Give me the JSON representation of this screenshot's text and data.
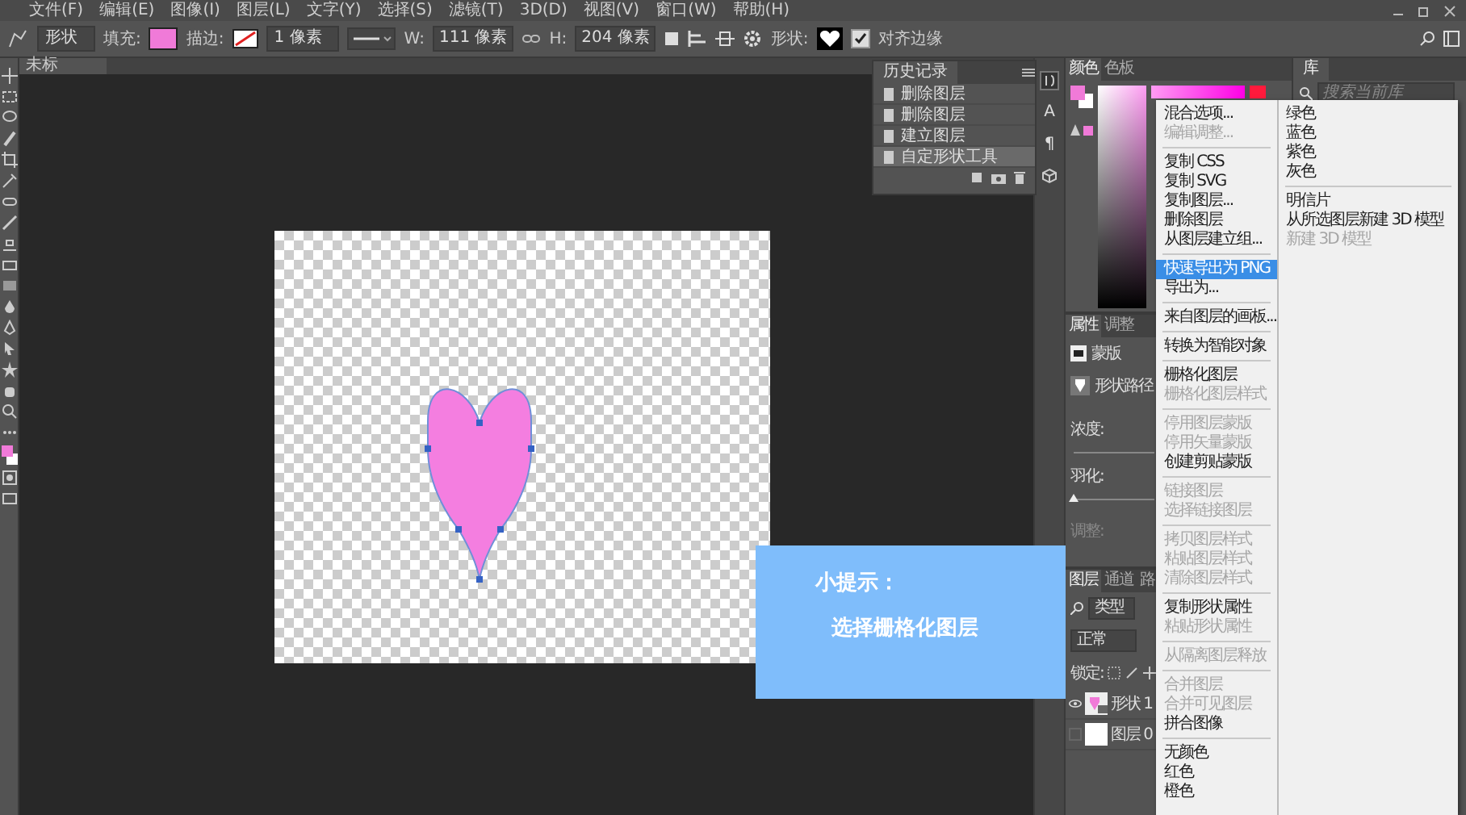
{
  "menu_bar": {
    "items": [
      "文件(F)",
      "编辑(E)",
      "图像(I)",
      "图层(L)",
      "文字(Y)",
      "选择(S)",
      "滤镜(T)",
      "3D(D)",
      "视图(V)",
      "窗口(W)",
      "帮助(H)"
    ]
  },
  "options_bar": {
    "tool_mode": "形状",
    "fill_label": "填充:",
    "stroke_label": "描边:",
    "stroke_width": "1 像素",
    "width_label": "W:",
    "width_value": "111 像素",
    "height_label": "H:",
    "height_value": "204 像素",
    "shape_label": "形状:",
    "align_edges": {
      "label": "对齐边缘",
      "checked": true
    }
  },
  "document": {
    "tab": "未标"
  },
  "history": {
    "title": "历史记录",
    "items": [
      {
        "label": "删除图层",
        "selected": false
      },
      {
        "label": "删除图层",
        "selected": false
      },
      {
        "label": "建立图层",
        "selected": false
      },
      {
        "label": "自定形状工具",
        "selected": true
      }
    ]
  },
  "panel_dock": {
    "glyph_buttons": [
      "A",
      "¶"
    ]
  },
  "color_panel": {
    "tabs": [
      {
        "label": "颜色",
        "selected": true
      },
      {
        "label": "色板",
        "selected": false
      }
    ]
  },
  "properties": {
    "tabs": [
      {
        "label": "属性",
        "selected": true
      },
      {
        "label": "调整",
        "selected": false
      }
    ],
    "mask_label": "蒙版",
    "shape_path_label": "形状路径",
    "density_label": "浓度:",
    "feather": {
      "label": "羽化:",
      "level": 0
    },
    "adjust": {
      "label": "调整:",
      "disabled": true
    }
  },
  "layers": {
    "tabs": [
      {
        "label": "图层",
        "selected": true
      },
      {
        "label": "通道",
        "selected": false
      },
      {
        "label": "路",
        "selected": false
      }
    ],
    "filter": "类型",
    "blend_mode": "正常",
    "lock_label": "锁定:",
    "items": [
      {
        "name": "形状 1",
        "visible": true,
        "kind": "shape"
      },
      {
        "name": "图层 0",
        "visible": false,
        "kind": "fill"
      }
    ]
  },
  "library": {
    "title": "库",
    "placeholder": "搜索当前库"
  },
  "context_menu": {
    "columns": [
      {
        "groups": [
          [
            {
              "label": "混合选项...",
              "disabled": false,
              "selected": false
            },
            {
              "label": "编辑调整...",
              "disabled": true,
              "selected": false
            }
          ],
          [
            {
              "label": "复制 CSS",
              "disabled": false,
              "selected": false
            },
            {
              "label": "复制 SVG",
              "disabled": false,
              "selected": false
            },
            {
              "label": "复制图层...",
              "disabled": false,
              "selected": false
            },
            {
              "label": "删除图层",
              "disabled": false,
              "selected": false
            },
            {
              "label": "从图层建立组...",
              "disabled": false,
              "selected": false
            }
          ],
          [
            {
              "label": "快速导出为 PNG",
              "disabled": false,
              "selected": true
            },
            {
              "label": "导出为...",
              "disabled": false,
              "selected": false
            }
          ],
          [
            {
              "label": "来自图层的画板...",
              "disabled": false,
              "selected": false
            }
          ],
          [
            {
              "label": "转换为智能对象",
              "disabled": false,
              "selected": false
            }
          ],
          [
            {
              "label": "栅格化图层",
              "disabled": false,
              "selected": false
            },
            {
              "label": "栅格化图层样式",
              "disabled": true,
              "selected": false
            }
          ],
          [
            {
              "label": "停用图层蒙版",
              "disabled": true,
              "selected": false
            },
            {
              "label": "停用矢量蒙版",
              "disabled": true,
              "selected": false
            },
            {
              "label": "创建剪贴蒙版",
              "disabled": false,
              "selected": false
            }
          ],
          [
            {
              "label": "链接图层",
              "disabled": true,
              "selected": false
            },
            {
              "label": "选择链接图层",
              "disabled": true,
              "selected": false
            }
          ],
          [
            {
              "label": "拷贝图层样式",
              "disabled": true,
              "selected": false
            },
            {
              "label": "粘贴图层样式",
              "disabled": true,
              "selected": false
            },
            {
              "label": "清除图层样式",
              "disabled": true,
              "selected": false
            }
          ],
          [
            {
              "label": "复制形状属性",
              "disabled": false,
              "selected": false
            },
            {
              "label": "粘贴形状属性",
              "disabled": true,
              "selected": false
            }
          ],
          [
            {
              "label": "从隔离图层释放",
              "disabled": true,
              "selected": false
            }
          ],
          [
            {
              "label": "合并图层",
              "disabled": true,
              "selected": false
            },
            {
              "label": "合并可见图层",
              "disabled": true,
              "selected": false
            },
            {
              "label": "拼合图像",
              "disabled": false,
              "selected": false
            }
          ],
          [
            {
              "label": "无颜色",
              "disabled": false,
              "selected": false
            },
            {
              "label": "红色",
              "disabled": false,
              "selected": false
            },
            {
              "label": "橙色",
              "disabled": false,
              "selected": false
            }
          ]
        ]
      },
      {
        "groups": [
          [
            {
              "label": "绿色",
              "disabled": false,
              "selected": false
            },
            {
              "label": "蓝色",
              "disabled": false,
              "selected": false
            },
            {
              "label": "紫色",
              "disabled": false,
              "selected": false
            },
            {
              "label": "灰色",
              "disabled": false,
              "selected": false
            }
          ],
          [
            {
              "label": "明信片",
              "disabled": false,
              "selected": false
            },
            {
              "label": "从所选图层新建 3D 模型",
              "disabled": false,
              "selected": false
            },
            {
              "label": "新建 3D 模型",
              "disabled": true,
              "selected": false
            }
          ]
        ]
      }
    ]
  },
  "tip": {
    "title": "小提示：",
    "text": "选择栅格化图层"
  }
}
